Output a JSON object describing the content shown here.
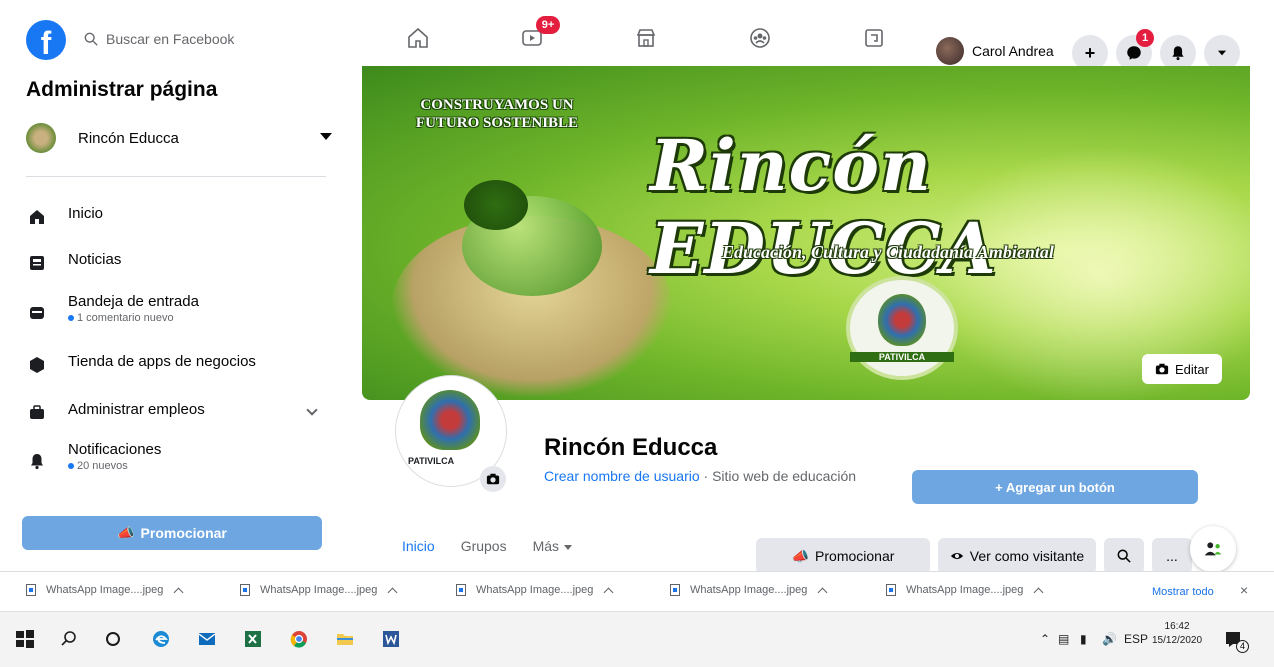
{
  "topbar": {
    "search_placeholder": "Buscar en Facebook",
    "video_badge": "9+",
    "profile_name": "Carol Andrea",
    "messenger_badge": "1"
  },
  "sidebar": {
    "title": "Administrar página",
    "page_name": "Rincón Educca",
    "items": [
      {
        "label": "Inicio",
        "sub": ""
      },
      {
        "label": "Noticias",
        "sub": ""
      },
      {
        "label": "Bandeja de entrada",
        "sub": "1 comentario nuevo"
      },
      {
        "label": "Tienda de apps de negocios",
        "sub": ""
      },
      {
        "label": "Administrar empleos",
        "sub": ""
      },
      {
        "label": "Notificaciones",
        "sub": "20 nuevos"
      }
    ],
    "promote_label": "Promocionar"
  },
  "cover": {
    "slogan": "CONSTRUYAMOS UN FUTURO SOSTENIBLE",
    "title": "Rincón EDUCCA",
    "tagline": "Educación, Cultura y Ciudadanía Ambiental",
    "seal_caption": "PATIVILCA",
    "edit_label": "Editar"
  },
  "page": {
    "avatar_caption": "PATIVILCA",
    "name": "Rincón Educca",
    "username_link": "Crear nombre de usuario",
    "category": " · Sitio web de educación",
    "add_button": "+ Agregar un botón"
  },
  "tabs": [
    "Inicio",
    "Grupos",
    "Más"
  ],
  "actions": {
    "promote": "Promocionar",
    "view_as": "Ver como visitante",
    "more": "..."
  },
  "downloads": {
    "files": [
      "WhatsApp Image....jpeg",
      "WhatsApp Image....jpeg",
      "WhatsApp Image....jpeg",
      "WhatsApp Image....jpeg",
      "WhatsApp Image....jpeg"
    ],
    "show_all": "Mostrar todo",
    "close": "×"
  },
  "taskbar": {
    "lang": "ESP",
    "time": "16:42",
    "date": "15/12/2020",
    "notif_count": "4"
  },
  "colors": {
    "facebook_blue": "#1877f2",
    "badge_red": "#e41e3f",
    "button_blue_light": "#6ea6e2",
    "cover_green": "#6fb52a"
  }
}
